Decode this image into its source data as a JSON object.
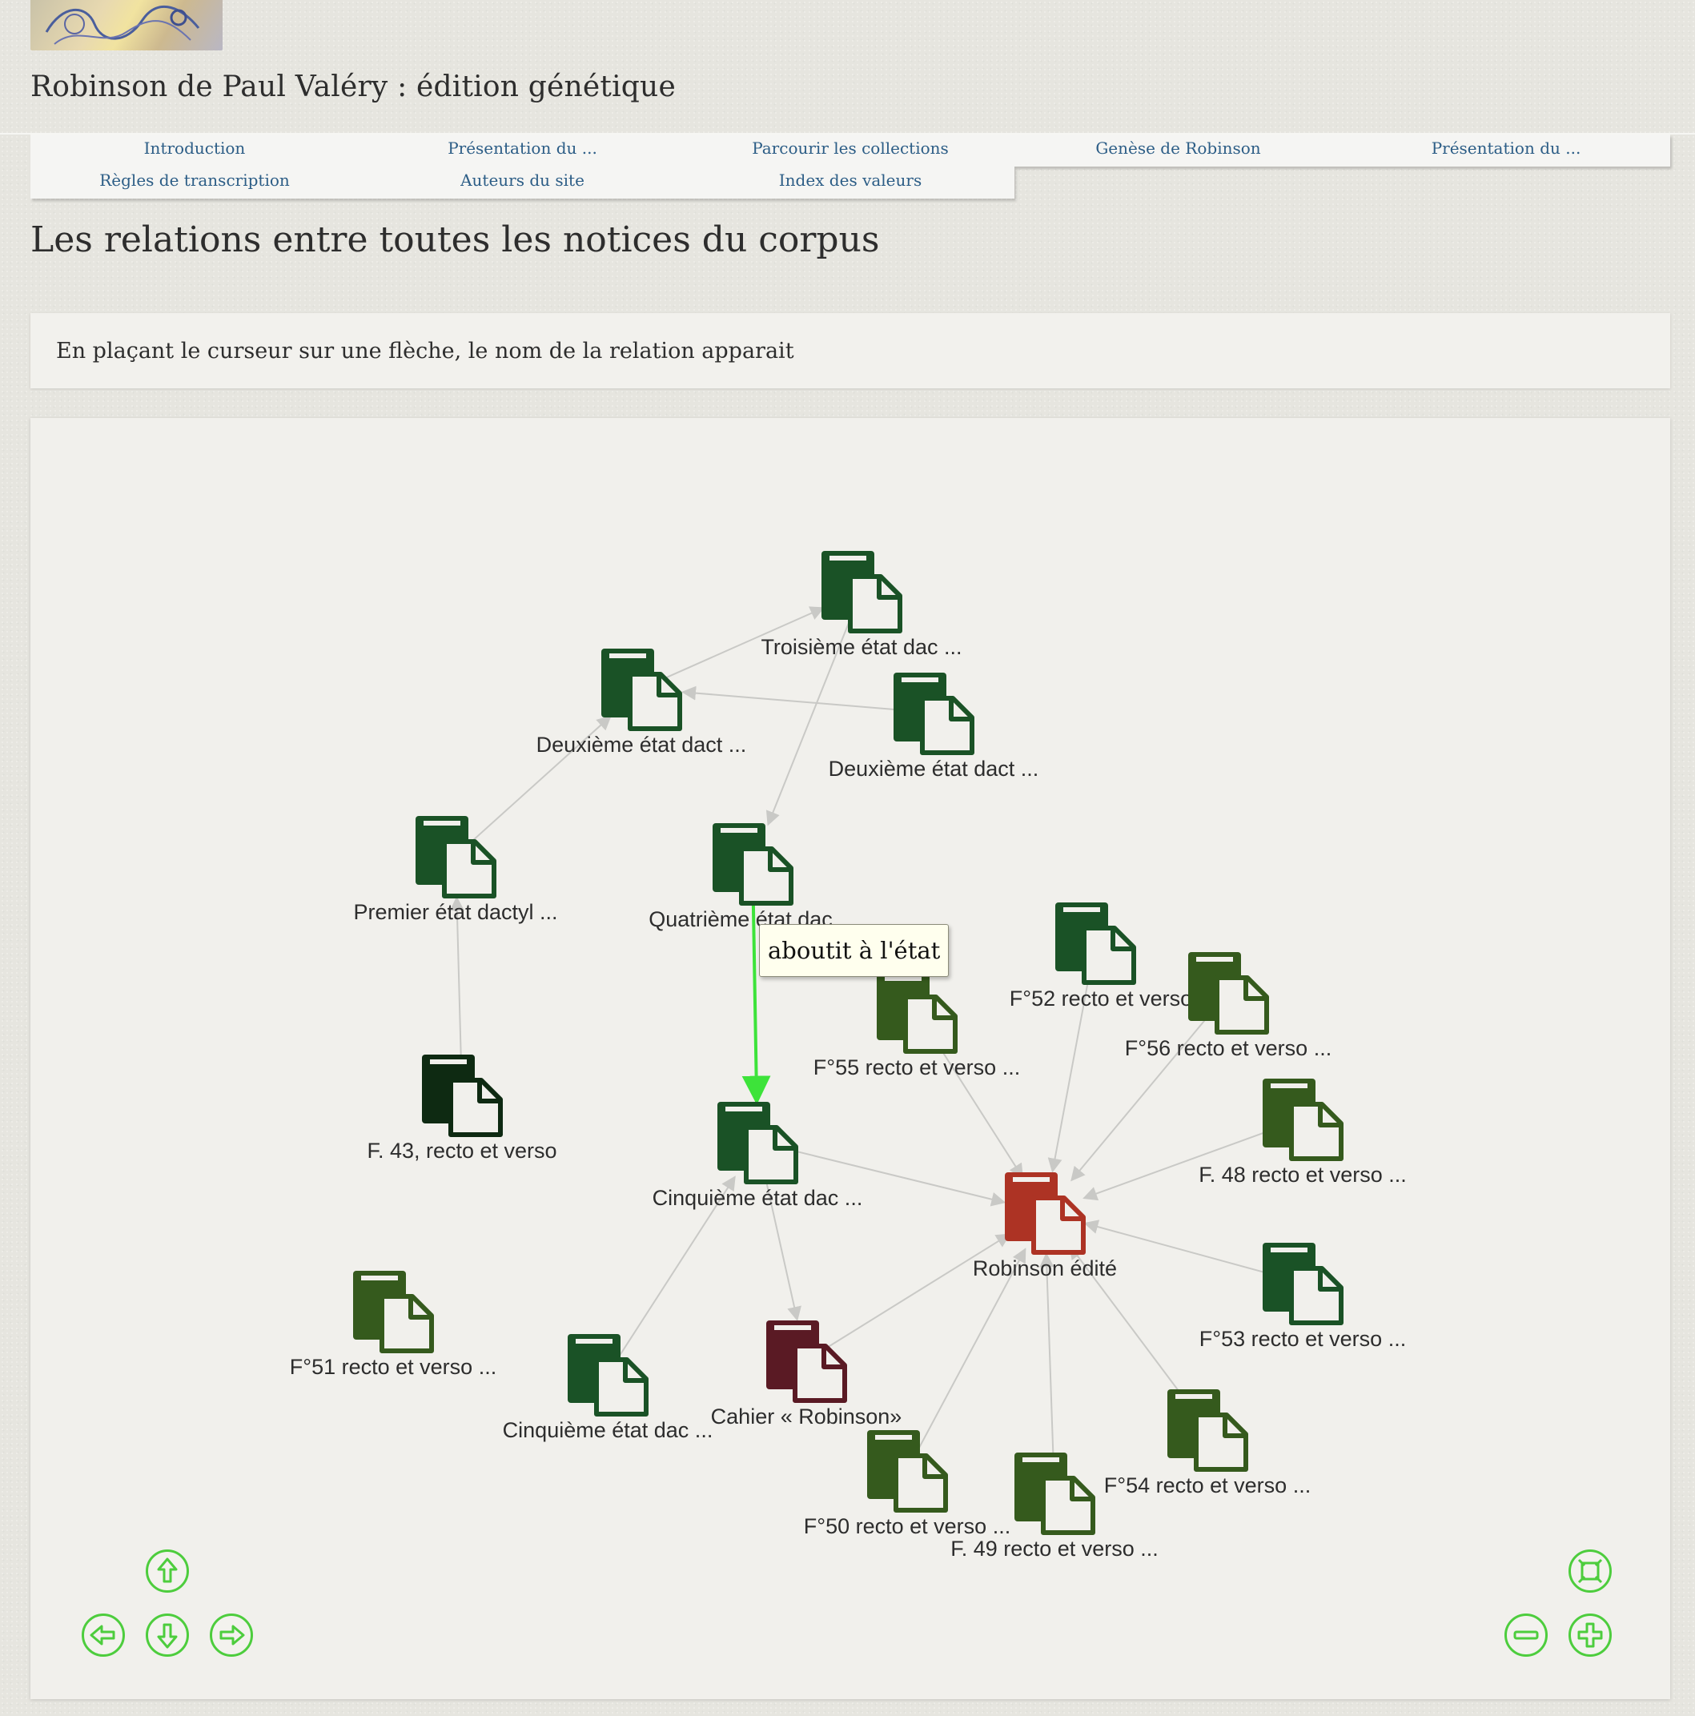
{
  "site": {
    "title": "Robinson de Paul Valéry : édition génétique"
  },
  "menu": {
    "row1": [
      "Introduction",
      "Présentation du ...",
      "Parcourir les collections",
      "Genèse de Robinson",
      "Présentation du ..."
    ],
    "row2": [
      "Règles de transcription",
      "Auteurs du site",
      "Index des valeurs"
    ]
  },
  "page": {
    "title": "Les relations entre toutes les notices du corpus",
    "hint": "En plaçant le curseur sur une flèche, le nom de la relation apparait"
  },
  "graph": {
    "tooltip": "aboutit à l'état",
    "colors": {
      "edge": "#c9c9c6",
      "highlight_edge": "#3de33a",
      "dark_green": "#1a5226",
      "olive_green": "#355a1d",
      "very_dark_green": "#0e2a12",
      "red": "#ad3324",
      "dark_red": "#5a1a24"
    },
    "nodes": [
      {
        "id": "troisieme",
        "label": "Troisième état dac ...",
        "color": "dark_green"
      },
      {
        "id": "deuxieme1",
        "label": "Deuxième état dact ...",
        "color": "dark_green"
      },
      {
        "id": "deuxieme2",
        "label": "Deuxième état dact ...",
        "color": "dark_green"
      },
      {
        "id": "premier",
        "label": "Premier état dactyl ...",
        "color": "dark_green"
      },
      {
        "id": "quatrieme",
        "label": "Quatrième état dac ...",
        "color": "dark_green"
      },
      {
        "id": "f52",
        "label": "F°52 recto et verso ...",
        "color": "dark_green"
      },
      {
        "id": "f56",
        "label": "F°56 recto et verso ...",
        "color": "olive_green"
      },
      {
        "id": "f55",
        "label": "F°55 recto et verso ...",
        "color": "olive_green"
      },
      {
        "id": "f43",
        "label": "F. 43, recto et verso",
        "color": "very_dark_green"
      },
      {
        "id": "cinquieme1",
        "label": "Cinquième état dac ...",
        "color": "dark_green"
      },
      {
        "id": "f48",
        "label": "F. 48 recto et verso ...",
        "color": "olive_green"
      },
      {
        "id": "robinson",
        "label": "Robinson édité",
        "color": "red"
      },
      {
        "id": "f51",
        "label": "F°51 recto et verso ...",
        "color": "olive_green"
      },
      {
        "id": "f53",
        "label": "F°53 recto et verso ...",
        "color": "dark_green"
      },
      {
        "id": "cinquieme2",
        "label": "Cinquième état dac ...",
        "color": "dark_green"
      },
      {
        "id": "cahier",
        "label": "Cahier « Robinson»",
        "color": "dark_red"
      },
      {
        "id": "f54",
        "label": "F°54 recto et verso ...",
        "color": "olive_green"
      },
      {
        "id": "f50",
        "label": "F°50 recto et verso ...",
        "color": "olive_green"
      },
      {
        "id": "f49",
        "label": "F. 49 recto et verso ...",
        "color": "olive_green"
      }
    ],
    "edges": [
      {
        "from": "deuxieme1",
        "to": "troisieme"
      },
      {
        "from": "deuxieme2",
        "to": "deuxieme1"
      },
      {
        "from": "premier",
        "to": "deuxieme1"
      },
      {
        "from": "troisieme",
        "to": "quatrieme"
      },
      {
        "from": "quatrieme",
        "to": "cinquieme1",
        "highlight": true
      },
      {
        "from": "f43",
        "to": "premier"
      },
      {
        "from": "cinquieme1",
        "to": "robinson"
      },
      {
        "from": "cinquieme2",
        "to": "cinquieme1"
      },
      {
        "from": "cinquieme1",
        "to": "cahier"
      },
      {
        "from": "cahier",
        "to": "robinson"
      },
      {
        "from": "f55",
        "to": "robinson"
      },
      {
        "from": "f52",
        "to": "robinson"
      },
      {
        "from": "f56",
        "to": "robinson"
      },
      {
        "from": "f48",
        "to": "robinson"
      },
      {
        "from": "f53",
        "to": "robinson"
      },
      {
        "from": "f54",
        "to": "robinson"
      },
      {
        "from": "f49",
        "to": "robinson"
      },
      {
        "from": "f50",
        "to": "robinson"
      }
    ]
  },
  "controls": {
    "up": "arrow-up-icon",
    "down": "arrow-down-icon",
    "left": "arrow-left-icon",
    "right": "arrow-right-icon",
    "zoom_in": "zoom-in-icon",
    "zoom_out": "zoom-out-icon",
    "fit": "fit-to-screen-icon"
  }
}
